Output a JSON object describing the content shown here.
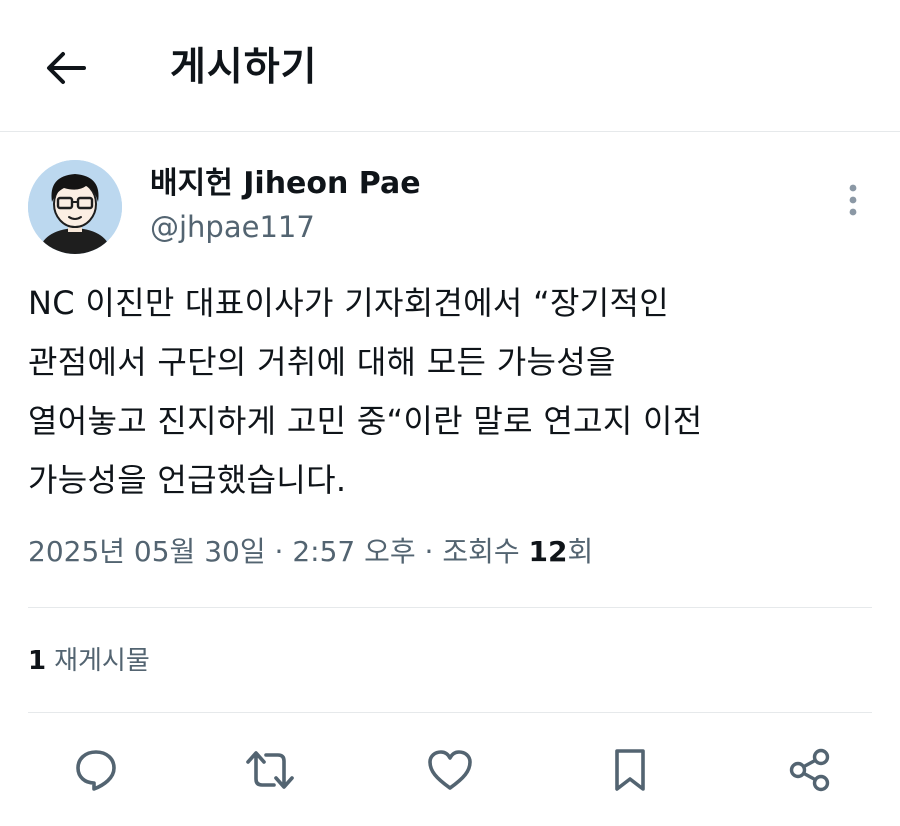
{
  "header": {
    "title": "게시하기",
    "back_icon": "arrow-left-icon"
  },
  "post": {
    "author": {
      "display_name": "배지헌 Jiheon Pae",
      "handle": "@jhpae117",
      "avatar_icon": "cartoon-avatar-icon"
    },
    "more_icon": "more-vertical-icon",
    "text": "NC 이진만 대표이사가 기자회견에서 “장기적인\n관점에서 구단의 거취에 대해 모든 가능성을\n열어놓고 진지하게 고민 중“이란 말로 연고지 이전\n가능성을 언급했습니다.",
    "meta": {
      "date": "2025년 05월 30일",
      "separator": "·",
      "time": "2:57 오후",
      "views_label": "조회수",
      "views_count": "12",
      "views_unit": "회"
    },
    "reposts": {
      "count": "1",
      "label": "재게시물"
    }
  },
  "actions": [
    {
      "name": "reply",
      "icon": "comment-icon"
    },
    {
      "name": "repost",
      "icon": "repost-icon"
    },
    {
      "name": "like",
      "icon": "heart-icon"
    },
    {
      "name": "bookmark",
      "icon": "bookmark-icon"
    },
    {
      "name": "share",
      "icon": "share-icon"
    }
  ],
  "colors": {
    "text_primary": "#0f1419",
    "text_secondary": "#536471",
    "divider": "#e6e9eb",
    "avatar_bg": "#bcd8ef"
  }
}
